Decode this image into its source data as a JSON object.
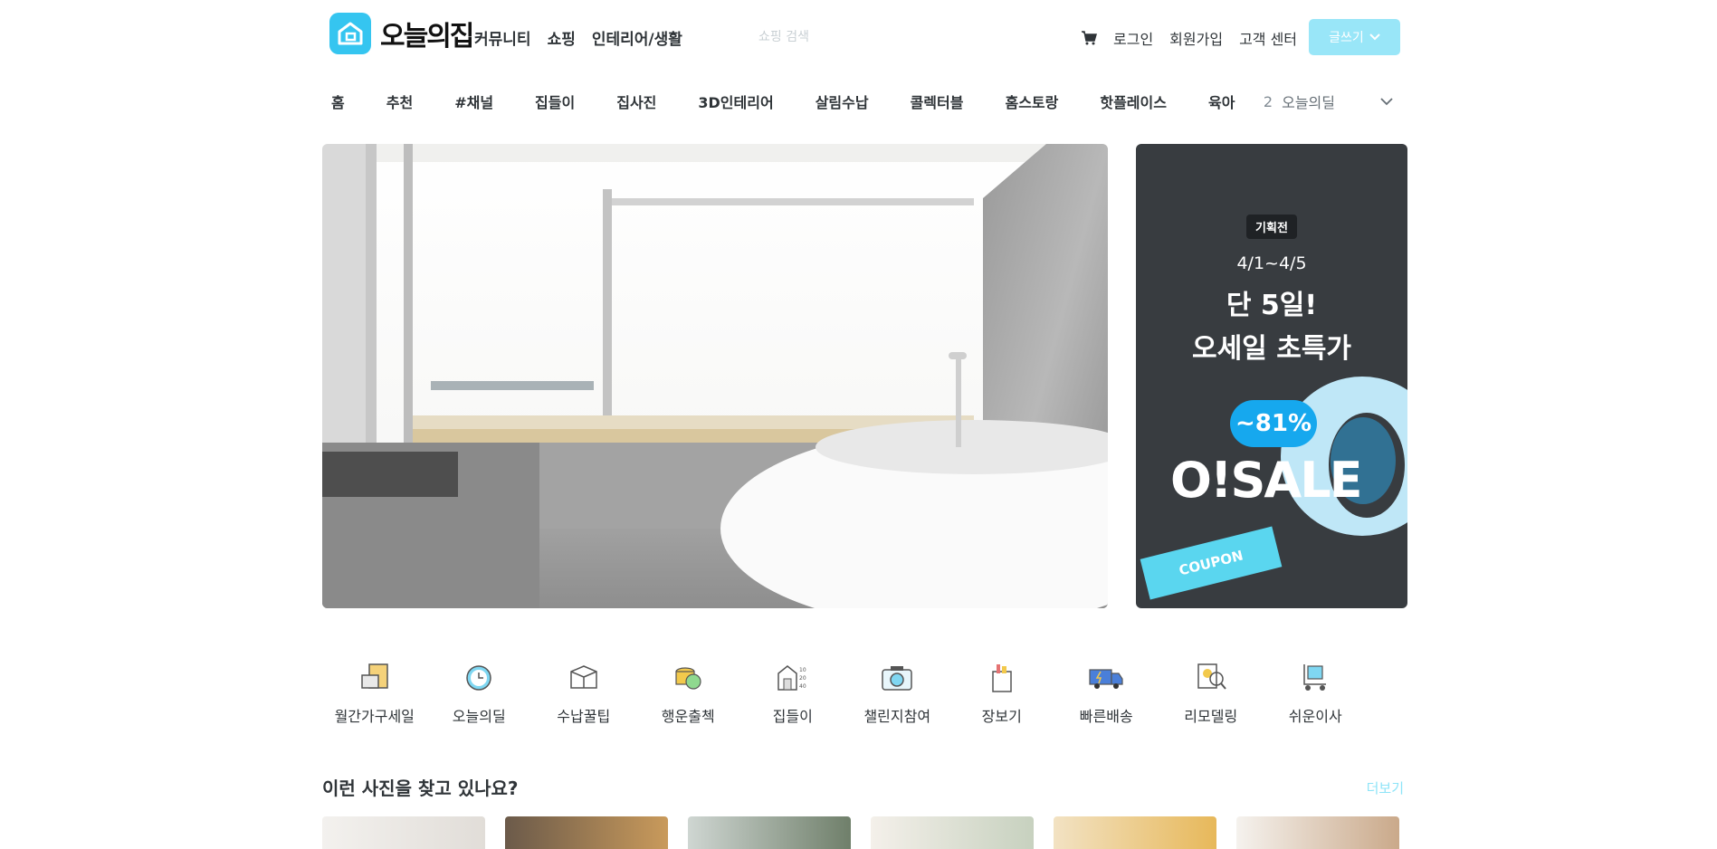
{
  "header": {
    "logo_text": "오늘의집",
    "nav": [
      "커뮤니티",
      "쇼핑",
      "인테리어/생활"
    ],
    "search_placeholder": "쇼핑 검색",
    "util": [
      "로그인",
      "회원가입",
      "고객 센터"
    ],
    "write_label": "글쓰기"
  },
  "subnav": {
    "items": [
      "홈",
      "추천",
      "#채널",
      "집들이",
      "집사진",
      "3D인테리어",
      "살림수납",
      "콜렉터블",
      "홈스토랑",
      "핫플레이스",
      "육아"
    ],
    "live_rank": "2",
    "live_keyword": "오늘의딜"
  },
  "banner": {
    "tag": "기획전",
    "date": "4/1~4/5",
    "title1": "단 5일!",
    "title2": "오세일 초특가",
    "discount": "~81%",
    "brand": "O!SALE",
    "coupon": "COUPON"
  },
  "categories": [
    {
      "label": "월간가구세일",
      "icon": "furniture-box-icon"
    },
    {
      "label": "오늘의딜",
      "icon": "alarm-clock-icon"
    },
    {
      "label": "수납꿀팁",
      "icon": "storage-box-icon"
    },
    {
      "label": "행운출첵",
      "icon": "coin-stack-icon"
    },
    {
      "label": "집들이",
      "icon": "house-floorplan-icon"
    },
    {
      "label": "챌린지참여",
      "icon": "camera-icon"
    },
    {
      "label": "장보기",
      "icon": "grocery-bag-icon"
    },
    {
      "label": "빠른배송",
      "icon": "delivery-truck-icon"
    },
    {
      "label": "리모델링",
      "icon": "remodeling-search-icon"
    },
    {
      "label": "쉬운이사",
      "icon": "moving-cart-icon"
    }
  ],
  "section": {
    "title": "이런 사진을 찾고 있나요?",
    "more": "더보기"
  },
  "colors": {
    "brand": "#35c5f0",
    "write_button": "#8ee4f8",
    "banner_bg": "#383c40"
  }
}
